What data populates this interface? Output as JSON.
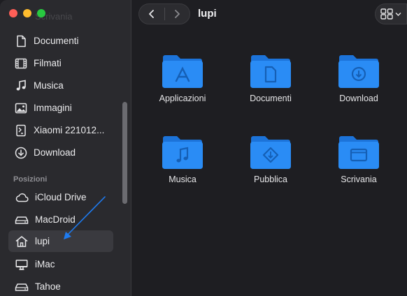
{
  "window": {
    "title": "lupi",
    "faded_header_text": "Scrivania",
    "accent": "#2a8cf5",
    "annotation_color": "#1e7bf0"
  },
  "sidebar": {
    "favorites": [
      {
        "label": "Documenti",
        "icon": "document-icon"
      },
      {
        "label": "Filmati",
        "icon": "film-icon"
      },
      {
        "label": "Musica",
        "icon": "music-icon"
      },
      {
        "label": "Immagini",
        "icon": "photo-icon"
      },
      {
        "label": "Xiaomi 221012...",
        "icon": "phone-icon"
      },
      {
        "label": "Download",
        "icon": "download-icon"
      }
    ],
    "locations_header": "Posizioni",
    "locations": [
      {
        "label": "iCloud Drive",
        "icon": "cloud-icon"
      },
      {
        "label": "MacDroid",
        "icon": "drive-icon"
      },
      {
        "label": "lupi",
        "icon": "home-icon",
        "selected": true
      },
      {
        "label": "iMac",
        "icon": "monitor-icon"
      },
      {
        "label": "Tahoe",
        "icon": "drive-icon"
      }
    ]
  },
  "folders": [
    {
      "label": "Applicazioni",
      "icon": "applications-folder-icon"
    },
    {
      "label": "Documenti",
      "icon": "documents-folder-icon"
    },
    {
      "label": "Download",
      "icon": "download-folder-icon"
    },
    {
      "label": "Musica",
      "icon": "music-folder-icon"
    },
    {
      "label": "Pubblica",
      "icon": "public-folder-icon"
    },
    {
      "label": "Scrivania",
      "icon": "desktop-folder-icon"
    }
  ]
}
